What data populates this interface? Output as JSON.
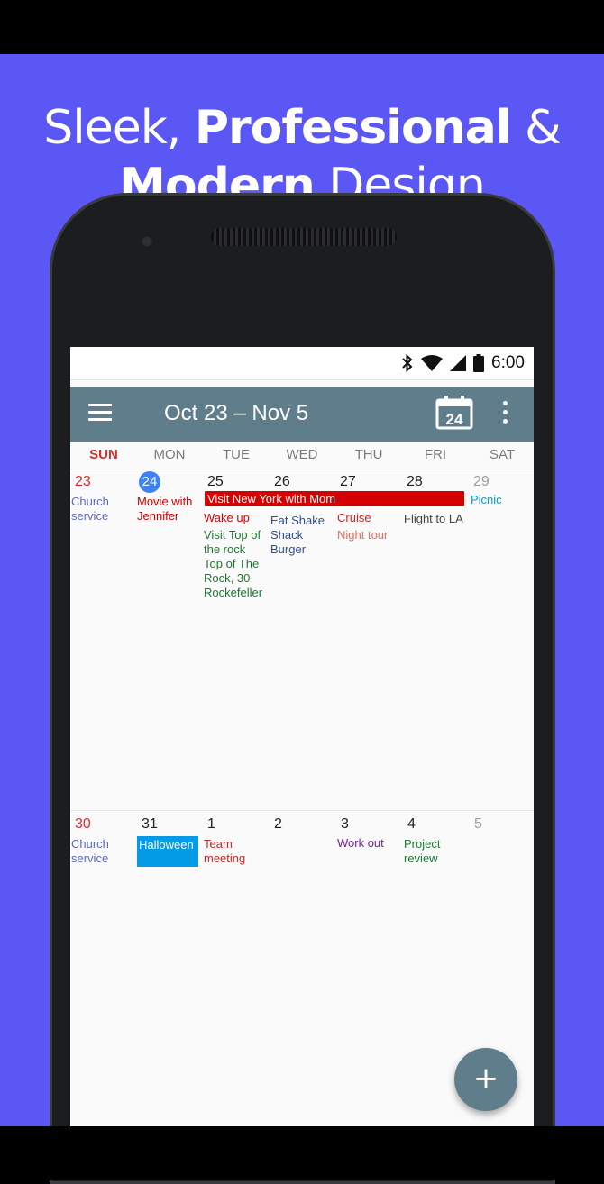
{
  "promo": {
    "line1_light": "Sleek,",
    "line1_bold": "Professional",
    "line1_end": "&",
    "line2_bold": "Modern",
    "line2_light": "Design"
  },
  "status_bar": {
    "time": "6:00",
    "icons": [
      "bluetooth-icon",
      "wifi-icon",
      "signal-icon",
      "battery-icon"
    ]
  },
  "app_bar": {
    "title": "Oct 23 – Nov 5",
    "today_label": "24",
    "bg_color": "#607d8b"
  },
  "weekdays": [
    "SUN",
    "MON",
    "TUE",
    "WED",
    "THU",
    "FRI",
    "SAT"
  ],
  "weeks": [
    {
      "days": [
        "23",
        "24",
        "25",
        "26",
        "27",
        "28",
        "29"
      ],
      "banner": "Visit New York with Mom",
      "events": {
        "sun": "Church service",
        "mon": "Movie with Jennifer",
        "tue_1": "Wake up",
        "tue_2": "Visit Top of the rock Top of The Rock, 30 Rockefeller",
        "wed": "Eat Shake Shack Burger",
        "thu_1": "Cruise",
        "thu_2": "Night tour",
        "fri": "Flight to LA",
        "sat": "Picnic"
      }
    },
    {
      "days": [
        "30",
        "31",
        "1",
        "2",
        "3",
        "4",
        "5"
      ],
      "events": {
        "sun": "Church service",
        "mon": "Halloween",
        "tue": "Team meeting",
        "thu": "Work out",
        "fri": "Project review"
      }
    }
  ],
  "fab_label": "+"
}
